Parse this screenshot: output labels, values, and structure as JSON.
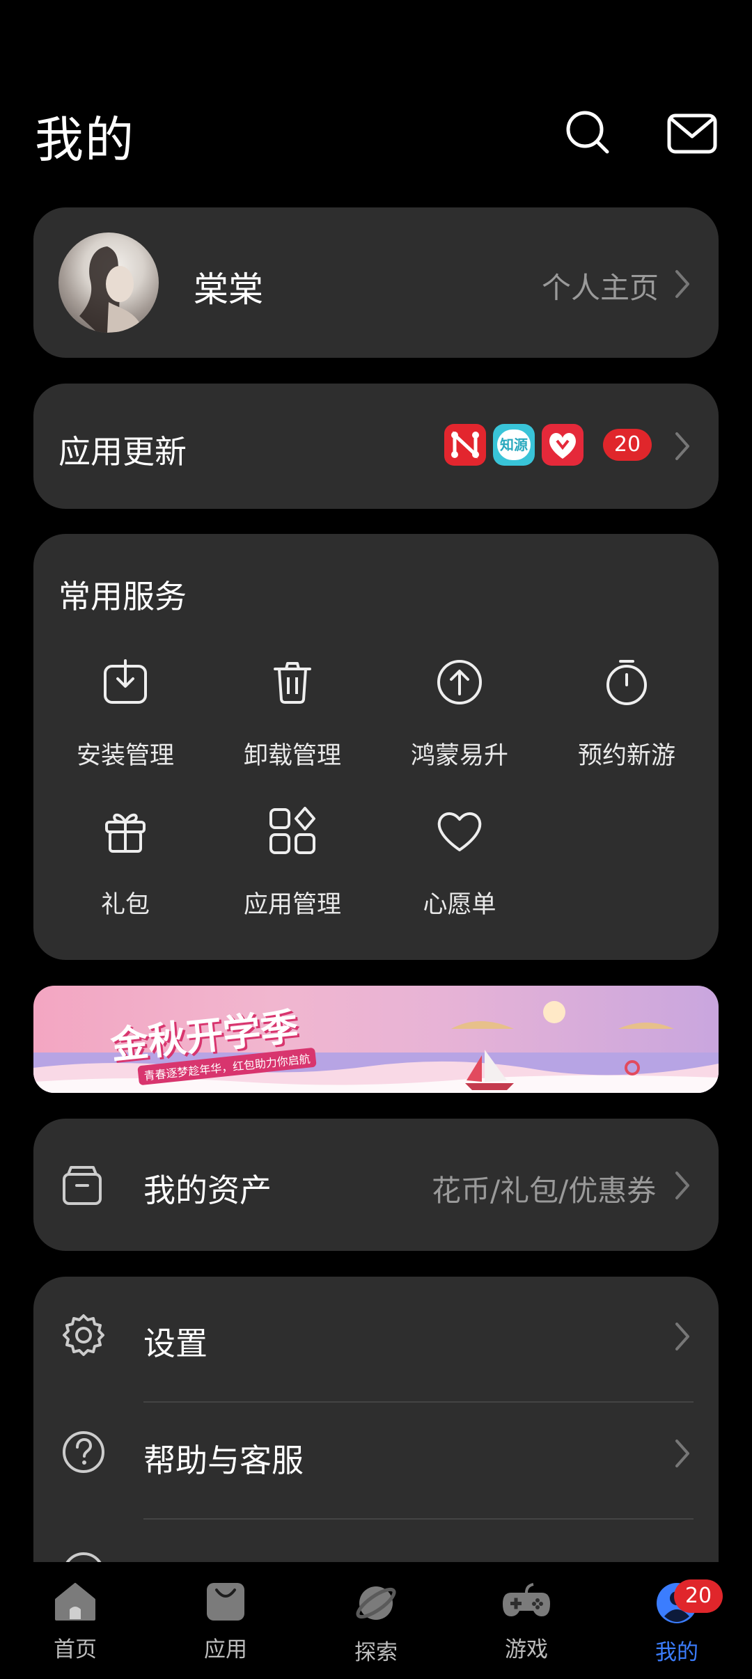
{
  "header": {
    "title": "我的",
    "search_icon": "search-icon",
    "mail_icon": "mail-icon"
  },
  "profile": {
    "name": "棠棠",
    "homepage_label": "个人主页"
  },
  "updates": {
    "label": "应用更新",
    "count": "20",
    "app_icons": [
      {
        "name": "red-network-app-icon",
        "color": "#e3262e"
      },
      {
        "name": "zhiyuan-app-icon",
        "text": "知源",
        "color": "#39c4d8"
      },
      {
        "name": "pinduoduo-app-icon",
        "color": "#e5293a"
      }
    ]
  },
  "services": {
    "title": "常用服务",
    "items": [
      {
        "label": "安装管理",
        "icon": "install-icon"
      },
      {
        "label": "卸载管理",
        "icon": "uninstall-icon"
      },
      {
        "label": "鸿蒙易升",
        "icon": "upgrade-icon"
      },
      {
        "label": "预约新游",
        "icon": "stopwatch-icon"
      },
      {
        "label": "礼包",
        "icon": "gift-icon"
      },
      {
        "label": "应用管理",
        "icon": "app-manage-icon"
      },
      {
        "label": "心愿单",
        "icon": "heart-icon"
      }
    ]
  },
  "banner": {
    "title": "金秋开学季",
    "subtitle": "青春逐梦趁年华，红包助力你启航"
  },
  "assets": {
    "label": "我的资产",
    "detail": "花币/礼包/优惠券"
  },
  "settings": {
    "items": [
      {
        "label": "设置",
        "icon": "settings-icon"
      },
      {
        "label": "帮助与客服",
        "icon": "help-icon"
      }
    ]
  },
  "tabbar": {
    "items": [
      {
        "label": "首页",
        "icon": "home-icon"
      },
      {
        "label": "应用",
        "icon": "apps-bag-icon"
      },
      {
        "label": "探索",
        "icon": "planet-icon"
      },
      {
        "label": "游戏",
        "icon": "gamepad-icon"
      },
      {
        "label": "我的",
        "icon": "profile-icon",
        "active": true,
        "badge": "20"
      }
    ],
    "active_color": "#3b7dfe"
  },
  "colors": {
    "card": "#2e2e2e",
    "badge": "#e0262b",
    "accent": "#3b7dfe"
  }
}
